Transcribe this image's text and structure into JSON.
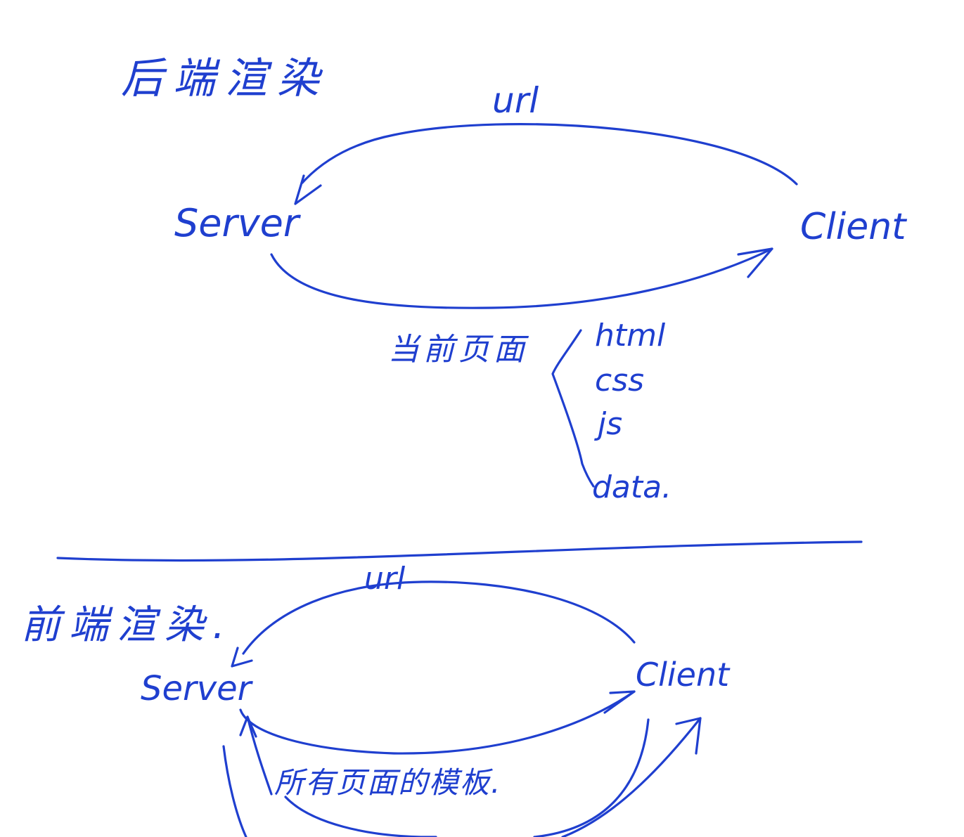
{
  "ink_color": "#1f3fcf",
  "background_color": "#ffffff",
  "top_section": {
    "title": "后端渲染",
    "server_label": "Server",
    "client_label": "Client",
    "request_label": "url",
    "response_label": "当前页面",
    "response_parts": [
      "html",
      "css",
      "js",
      "data."
    ]
  },
  "bottom_section": {
    "title": "前端渲染.",
    "server_label": "Server",
    "client_label": "Client",
    "request_label": "url",
    "response_label": "所有页面的模板."
  }
}
